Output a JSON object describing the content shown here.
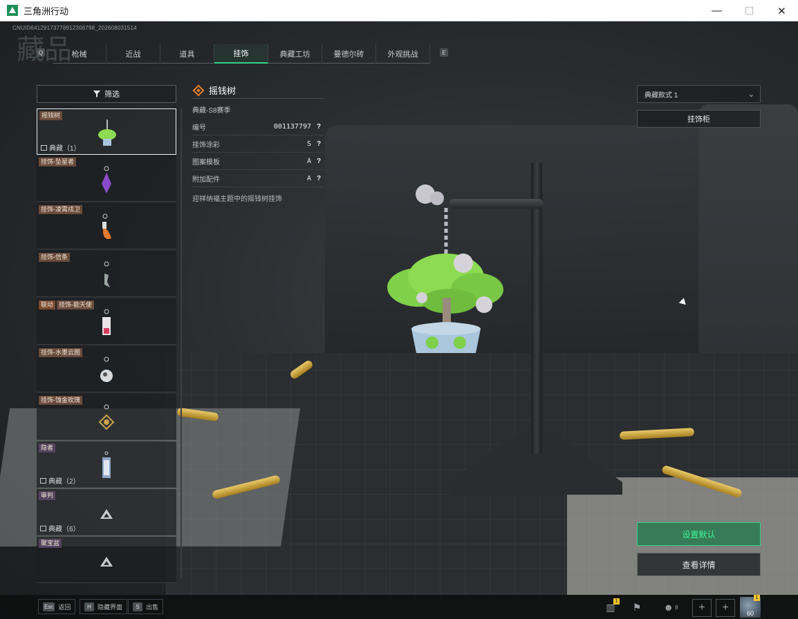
{
  "window": {
    "title": "三角洲行动",
    "minimize": "—",
    "maximize": "☐",
    "close": "✕"
  },
  "uid": "CNUID6412917377891230679​8_2026080315​14",
  "bg_heading": "藏品",
  "tabs": {
    "prev_key": "Q",
    "next_key": "E",
    "items": [
      {
        "label": "枪械"
      },
      {
        "label": "近战"
      },
      {
        "label": "道具"
      },
      {
        "label": "挂饰"
      },
      {
        "label": "典藏工坊"
      },
      {
        "label": "曼德尔砖"
      },
      {
        "label": "外观挑战"
      }
    ],
    "active_index": 3
  },
  "filter": {
    "label": "筛选"
  },
  "items": [
    {
      "tags": [
        {
          "text": "摇钱树",
          "style": "brown"
        }
      ],
      "count": "典藏（1）",
      "icon": "money-tree-charm-icon",
      "selected": true
    },
    {
      "tags": [
        {
          "text": "挂饰-坠星者",
          "style": "brown"
        }
      ],
      "count": "",
      "icon": "crystal-charm-icon"
    },
    {
      "tags": [
        {
          "text": "挂饰-凌霄戍卫",
          "style": "brown"
        }
      ],
      "count": "",
      "icon": "flame-charm-icon"
    },
    {
      "tags": [
        {
          "text": "挂饰-信条",
          "style": "brown"
        }
      ],
      "count": "",
      "icon": "figure-charm-icon"
    },
    {
      "tags": [
        {
          "text": "联动",
          "style": "collab"
        },
        {
          "text": "挂饰-能天使",
          "style": "brown"
        }
      ],
      "count": "",
      "icon": "card-charm-icon"
    },
    {
      "tags": [
        {
          "text": "挂饰-水墨云图",
          "style": "brown"
        }
      ],
      "count": "",
      "icon": "orb-charm-icon"
    },
    {
      "tags": [
        {
          "text": "挂饰-蚀金玫瑰",
          "style": "brown"
        }
      ],
      "count": "",
      "icon": "rose-charm-icon"
    },
    {
      "tags": [
        {
          "text": "隐者",
          "style": "purple"
        }
      ],
      "count": "典藏（2）",
      "icon": "tag-charm-icon"
    },
    {
      "tags": [
        {
          "text": "审判",
          "style": "purple"
        }
      ],
      "count": "典藏（6）",
      "icon": "delta-logo-icon"
    },
    {
      "tags": [
        {
          "text": "聚宝盆",
          "style": "purple"
        }
      ],
      "count": "",
      "icon": "delta-logo-icon"
    }
  ],
  "detail": {
    "title": "摇钱树",
    "season": "典藏-S8赛季",
    "rows": [
      {
        "label": "编号",
        "value": "001137797",
        "help": "?"
      },
      {
        "label": "挂饰涂彩",
        "value": "S",
        "help": "?"
      },
      {
        "label": "图案模板",
        "value": "A",
        "help": "?"
      },
      {
        "label": "附加配件",
        "value": "A",
        "help": "?"
      }
    ],
    "description": "迎祥纳福主题中的摇钱树挂饰"
  },
  "style_select": {
    "value": "典藏款式 1"
  },
  "cabinet_button": "挂饰柜",
  "default_button": "设置默认",
  "details_button": "查看详情",
  "bottom": {
    "hints": [
      {
        "key": "Esc",
        "label": "返回"
      },
      {
        "key": "H",
        "label": "隐藏界面"
      },
      {
        "key": "S",
        "label": "出售"
      }
    ],
    "stats_badge": "1",
    "friends_count": "8",
    "level_badge": "1",
    "level": "60"
  },
  "colors": {
    "accent": "#35d38a",
    "tag_brown": "#6a4b3a",
    "tag_purple": "#55435e"
  }
}
